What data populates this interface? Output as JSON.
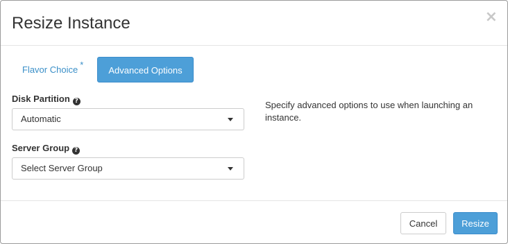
{
  "dialog": {
    "title": "Resize Instance",
    "close_glyph": "×"
  },
  "tabs": [
    {
      "label": "Flavor Choice",
      "required_mark": "*",
      "active": false
    },
    {
      "label": "Advanced Options",
      "active": true
    }
  ],
  "form": {
    "disk_partition": {
      "label": "Disk Partition",
      "help_glyph": "?",
      "value": "Automatic"
    },
    "server_group": {
      "label": "Server Group",
      "help_glyph": "?",
      "value": "Select Server Group"
    }
  },
  "help_text": "Specify advanced options to use when launching an instance.",
  "footer": {
    "cancel_label": "Cancel",
    "submit_label": "Resize"
  },
  "icons": {
    "close": "close-icon",
    "help": "question-circle-icon",
    "dropdown": "caret-down-icon"
  },
  "colors": {
    "primary": "#4d9fd8",
    "link": "#3a8fc8",
    "close": "#c8c8c8"
  }
}
